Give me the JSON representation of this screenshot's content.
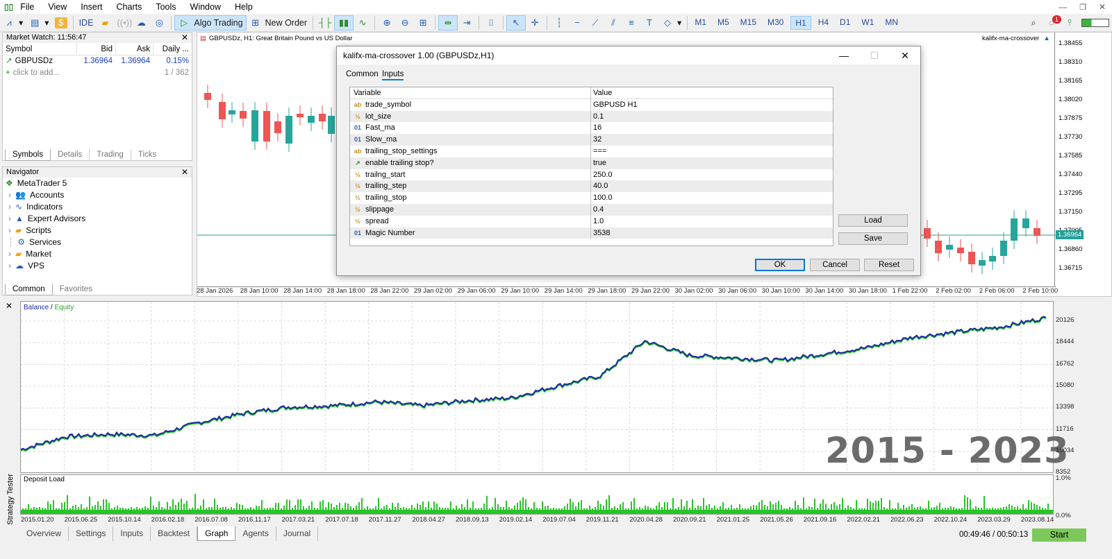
{
  "menu": [
    "File",
    "View",
    "Insert",
    "Charts",
    "Tools",
    "Window",
    "Help"
  ],
  "toolbar": {
    "ide": "IDE",
    "algo_trading": "Algo Trading",
    "new_order": "New Order",
    "timeframes": [
      "M1",
      "M5",
      "M15",
      "M30",
      "H1",
      "H4",
      "D1",
      "W1",
      "MN"
    ],
    "active_timeframe": "H1",
    "notify_count": "1"
  },
  "market_watch": {
    "title": "Market Watch: 11:56:47",
    "columns": [
      "Symbol",
      "Bid",
      "Ask",
      "Daily ..."
    ],
    "rows": [
      {
        "symbol": "GBPUSDz",
        "bid": "1.36964",
        "ask": "1.36964",
        "daily": "0.15%"
      }
    ],
    "add_label": "click to add...",
    "count": "1 / 362",
    "tabs": [
      "Symbols",
      "Details",
      "Trading",
      "Ticks"
    ]
  },
  "navigator": {
    "title": "Navigator",
    "root": "MetaTrader 5",
    "items": [
      "Accounts",
      "Indicators",
      "Expert Advisors",
      "Scripts",
      "Services",
      "Market",
      "VPS"
    ],
    "tabs": [
      "Common",
      "Favorites"
    ]
  },
  "chart": {
    "symbol_label": "GBPUSDz, H1:  Great Britain Pound vs US Dollar",
    "ea_label": "kalifx-ma-crossover",
    "price_labels": [
      "1.38455",
      "1.38310",
      "1.38165",
      "1.38020",
      "1.37875",
      "1.37730",
      "1.37585",
      "1.37440",
      "1.37295",
      "1.37150",
      "1.37005",
      "1.36860",
      "1.36715"
    ],
    "current_price": "1.36964",
    "time_labels": [
      "28 Jan 2026",
      "28 Jan 10:00",
      "28 Jan 14:00",
      "28 Jan 18:00",
      "28 Jan 22:00",
      "29 Jan 02:00",
      "29 Jan 06:00",
      "29 Jan 10:00",
      "29 Jan 14:00",
      "29 Jan 18:00",
      "29 Jan 22:00",
      "30 Jan 02:00",
      "30 Jan 06:00",
      "30 Jan 10:00",
      "30 Jan 14:00",
      "30 Jan 18:00",
      "1 Feb 22:00",
      "2 Feb 02:00",
      "2 Feb 06:00",
      "2 Feb 10:00"
    ]
  },
  "dialog": {
    "title": "kalifx-ma-crossover 1.00 (GBPUSDz,H1)",
    "tabs": [
      "Common",
      "Inputs"
    ],
    "columns": [
      "Variable",
      "Value"
    ],
    "params": [
      {
        "icon": "ab",
        "name": "trade_symbol",
        "value": "GBPUSD H1"
      },
      {
        "icon": "½",
        "name": "lot_size",
        "value": "0.1"
      },
      {
        "icon": "01",
        "name": "Fast_ma",
        "value": "16"
      },
      {
        "icon": "01",
        "name": "Slow_ma",
        "value": "32"
      },
      {
        "icon": "ab",
        "name": "trailing_stop_settings",
        "value": "==="
      },
      {
        "icon": "↗",
        "name": "enable trailing stop?",
        "value": "true"
      },
      {
        "icon": "½",
        "name": "trailng_start",
        "value": "250.0"
      },
      {
        "icon": "½",
        "name": "trailing_step",
        "value": "40.0"
      },
      {
        "icon": "½",
        "name": "trailing_stop",
        "value": "100.0"
      },
      {
        "icon": "½",
        "name": "slippage",
        "value": "0.4"
      },
      {
        "icon": "½",
        "name": "spread",
        "value": "1.0"
      },
      {
        "icon": "01",
        "name": "Magic Number",
        "value": "3538"
      }
    ],
    "load": "Load",
    "save": "Save",
    "ok": "OK",
    "cancel": "Cancel",
    "reset": "Reset"
  },
  "tester": {
    "side_label": "Strategy Tester",
    "legend_balance": "Balance",
    "legend_slash": " / ",
    "legend_equity": "Equity",
    "y_labels": [
      "20126",
      "18444",
      "16762",
      "15080",
      "13398",
      "11716",
      "10034",
      "8352"
    ],
    "overlay": "2015 - 2023",
    "deposit_label": "Deposit Load",
    "deposit_y": [
      "1.0%",
      "0.0%"
    ],
    "x_labels": [
      "2015.01.20",
      "2015.06.25",
      "2015.10.14",
      "2016.02.18",
      "2016.07.08",
      "2016.11.17",
      "2017.03.21",
      "2017.07.18",
      "2017.11.27",
      "2018.04.27",
      "2018.09.13",
      "2019.02.14",
      "2019.07.04",
      "2019.11.21",
      "2020.04.28",
      "2020.09.21",
      "2021.01.25",
      "2021.05.26",
      "2021.09.16",
      "2022.02.21",
      "2022.06.23",
      "2022.10.24",
      "2023.03.29",
      "2023.08.14"
    ],
    "tabs": [
      "Overview",
      "Settings",
      "Inputs",
      "Backtest",
      "Graph",
      "Agents",
      "Journal"
    ],
    "active_tab": "Graph",
    "timer": "00:49:46 / 00:50:13",
    "start": "Start"
  },
  "chart_data": {
    "type": "line",
    "series": [
      {
        "name": "Balance",
        "x": [
          "2015.01.20",
          "2015.06.25",
          "2015.10.14",
          "2016.02.18",
          "2016.07.08",
          "2016.11.17",
          "2017.03.21",
          "2017.07.18",
          "2017.11.27",
          "2018.04.27",
          "2018.09.13",
          "2019.02.14",
          "2019.07.04",
          "2019.11.21",
          "2020.04.28",
          "2020.09.21",
          "2021.01.25",
          "2021.05.26",
          "2021.09.16",
          "2022.02.21",
          "2022.06.23",
          "2022.10.24",
          "2023.03.29",
          "2023.08.14"
        ],
        "values": [
          9900,
          10900,
          11100,
          11000,
          12000,
          12700,
          13200,
          13300,
          13600,
          13300,
          13700,
          13900,
          14800,
          15600,
          18300,
          17200,
          17000,
          16800,
          17300,
          17800,
          18600,
          19000,
          19400,
          20100
        ]
      },
      {
        "name": "Equity"
      }
    ],
    "ylim": [
      8352,
      20800
    ]
  }
}
